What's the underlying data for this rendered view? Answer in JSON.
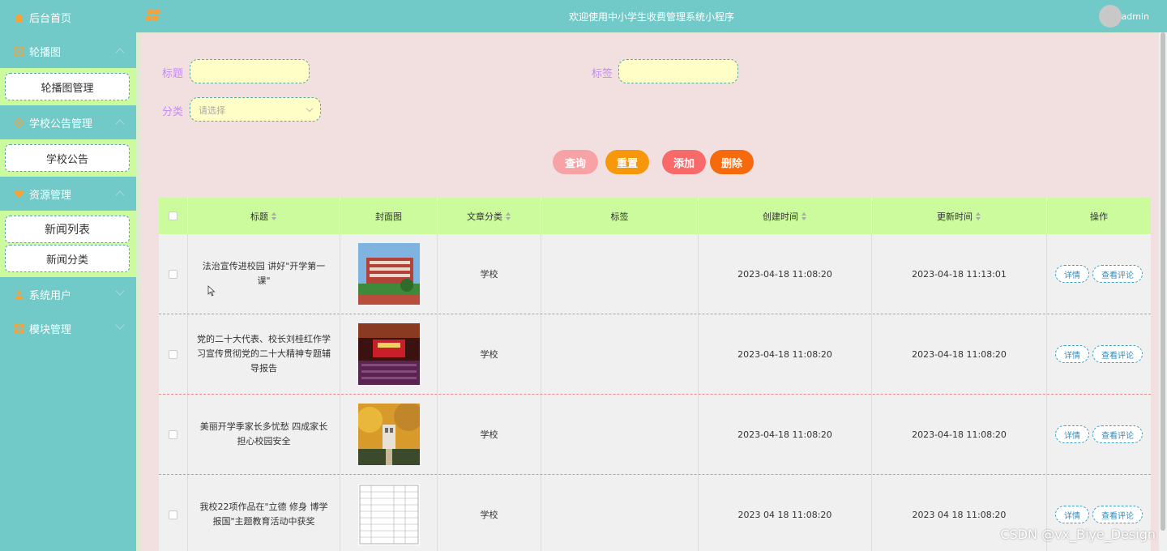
{
  "header": {
    "title": "欢迎使用中小学生收费管理系统小程序",
    "username": "admin"
  },
  "sidebar": {
    "home": "后台首页",
    "groups": [
      {
        "label": "轮播图",
        "items": [
          "轮播图管理"
        ]
      },
      {
        "label": "学校公告管理",
        "items": [
          "学校公告"
        ]
      },
      {
        "label": "资源管理",
        "items": [
          "新闻列表",
          "新闻分类"
        ]
      },
      {
        "label": "系统用户",
        "items": []
      },
      {
        "label": "模块管理",
        "items": []
      }
    ]
  },
  "filters": {
    "title_label": "标题",
    "tag_label": "标签",
    "category_label": "分类",
    "category_placeholder": "请选择"
  },
  "buttons": {
    "search": "查询",
    "reset": "重置",
    "add": "添加",
    "delete": "删除"
  },
  "table": {
    "headers": [
      "标题",
      "封面图",
      "文章分类",
      "标签",
      "创建时间",
      "更新时间",
      "操作"
    ],
    "rows": [
      {
        "title": "法治宣传进校园 讲好\"开学第一课\"",
        "category": "学校",
        "tag": "",
        "created": "2023-04-18 11:08:20",
        "updated": "2023-04-18 11:13:01"
      },
      {
        "title": "党的二十大代表、校长刘桂红作学习宣传贯彻党的二十大精神专题辅导报告",
        "category": "学校",
        "tag": "",
        "created": "2023-04-18 11:08:20",
        "updated": "2023-04-18 11:08:20"
      },
      {
        "title": "美丽开学季家长多忧愁 四成家长担心校园安全",
        "category": "学校",
        "tag": "",
        "created": "2023-04-18 11:08:20",
        "updated": "2023-04-18 11:08:20"
      },
      {
        "title": "我校22项作品在\"立德 修身 博学 报国\"主题教育活动中获奖",
        "category": "学校",
        "tag": "",
        "created": "2023 04 18 11:08:20",
        "updated": "2023 04 18 11:08:20"
      }
    ],
    "op_detail": "详情",
    "op_comments": "查看评论"
  },
  "watermark": "CSDN @vx_Biye_Design",
  "colors": {
    "sidebar_bg": "#71c9c8",
    "submenu_bg": "#cbfb9d",
    "content_bg": "#f2e0e0",
    "input_bg": "#fefec6",
    "label_color": "#c58cf3",
    "btn_search": "#f7a3a6",
    "btn_reset": "#f6970c",
    "btn_add": "#f86a6a",
    "btn_delete": "#f6690c"
  }
}
